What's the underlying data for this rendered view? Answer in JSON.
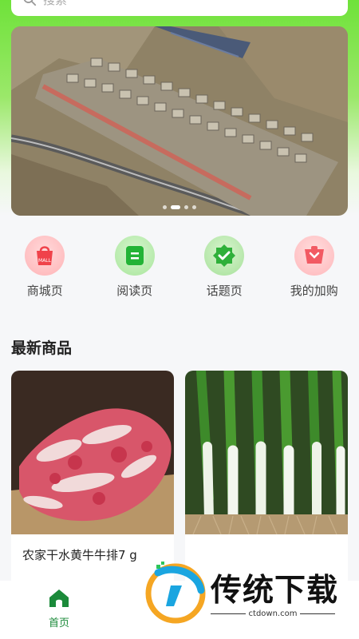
{
  "search": {
    "placeholder": "搜索"
  },
  "banner": {
    "slides": 4,
    "active_slide": 1
  },
  "quick_nav": [
    {
      "label": "商城页",
      "icon": "shopping-bag-icon",
      "color": "#f0424a",
      "badge": "MALL"
    },
    {
      "label": "阅读页",
      "icon": "reading-icon",
      "color": "#22b336"
    },
    {
      "label": "话题页",
      "icon": "topic-badge-icon",
      "color": "#2fb03a"
    },
    {
      "label": "我的加购",
      "icon": "cart-icon",
      "color": "#f25a63"
    }
  ],
  "section": {
    "title": "最新商品"
  },
  "products": [
    {
      "title": "农家干水黄牛牛排7 g",
      "image": "beef-ribs-image"
    },
    {
      "title": "",
      "image": "green-onion-image"
    }
  ],
  "tabbar": {
    "home_label": "首页",
    "home_icon": "home-icon",
    "accent": "#1b8a3a"
  },
  "watermark": {
    "brand": "传统下载",
    "domain": "ctdown.com"
  }
}
